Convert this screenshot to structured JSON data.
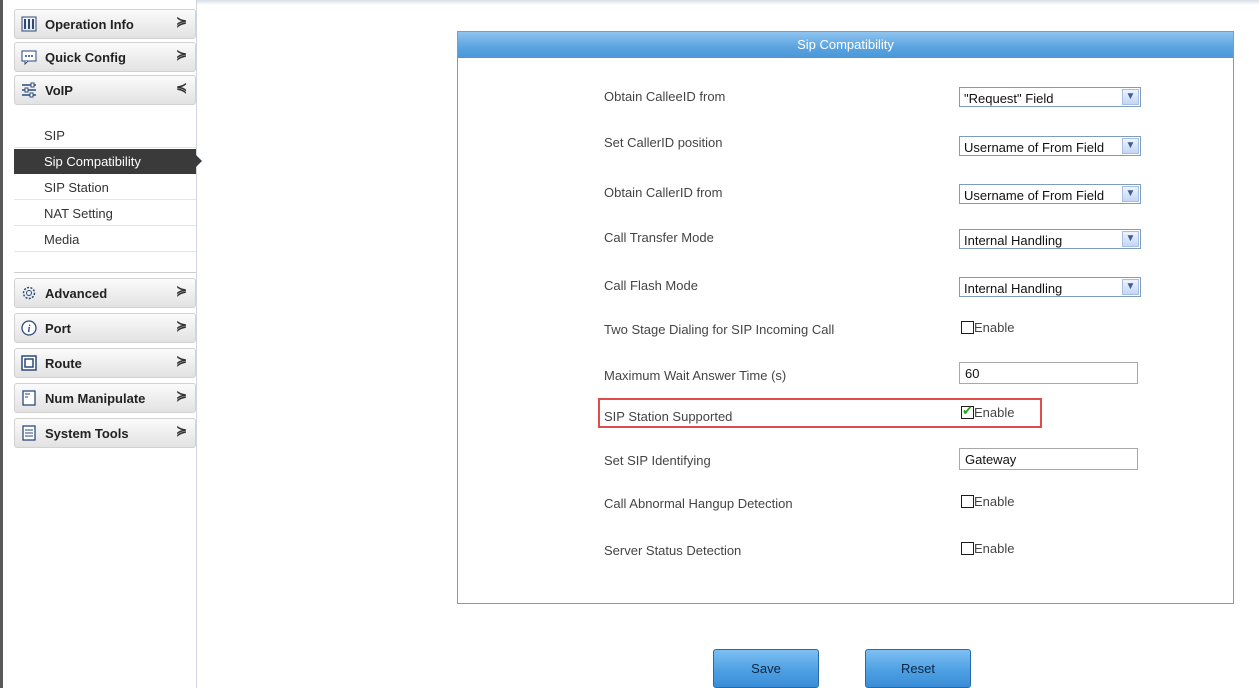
{
  "sidebar": {
    "nav": [
      {
        "label": "Operation Info",
        "icon": "bar-chart-icon",
        "chevron": "≽"
      },
      {
        "label": "Quick Config",
        "icon": "chat-icon",
        "chevron": "≽"
      },
      {
        "label": "VoIP",
        "icon": "sliders-icon",
        "chevron": "≼"
      },
      {
        "label": "Advanced",
        "icon": "gear-icon",
        "chevron": "≽"
      },
      {
        "label": "Port",
        "icon": "info-icon",
        "chevron": "≽"
      },
      {
        "label": "Route",
        "icon": "square-icon",
        "chevron": "≽"
      },
      {
        "label": "Num Manipulate",
        "icon": "document-icon",
        "chevron": "≽"
      },
      {
        "label": "System Tools",
        "icon": "notepad-icon",
        "chevron": "≽"
      }
    ],
    "voip_items": [
      {
        "label": "SIP"
      },
      {
        "label": "Sip Compatibility"
      },
      {
        "label": "SIP Station"
      },
      {
        "label": "NAT Setting"
      },
      {
        "label": "Media"
      }
    ]
  },
  "panel": {
    "title": "Sip Compatibility",
    "rows": [
      {
        "label": "Obtain CalleeID from",
        "value": "\"Request\" Field"
      },
      {
        "label": "Set CallerID position",
        "value": "Username of From Field"
      },
      {
        "label": "Obtain CallerID from",
        "value": "Username of From Field"
      },
      {
        "label": "Call Transfer Mode",
        "value": "Internal Handling"
      },
      {
        "label": "Call Flash Mode",
        "value": "Internal Handling"
      },
      {
        "label": "Two Stage Dialing for SIP Incoming Call",
        "value": "Enable",
        "checked": false
      },
      {
        "label": "Maximum Wait Answer Time (s)",
        "value": "60"
      },
      {
        "label": "SIP Station Supported",
        "value": "Enable",
        "checked": true
      },
      {
        "label": "Set SIP Identifying",
        "value": "Gateway"
      },
      {
        "label": "Call Abnormal Hangup Detection",
        "value": "Enable",
        "checked": false
      },
      {
        "label": "Server Status Detection",
        "value": "Enable",
        "checked": false
      }
    ]
  },
  "buttons": {
    "save": "Save",
    "reset": "Reset"
  },
  "colors": {
    "panel_header": "#5aa3e0",
    "active_item": "#3a3a3a",
    "highlight": "#e24b4b",
    "button": "#4ea0e4"
  }
}
